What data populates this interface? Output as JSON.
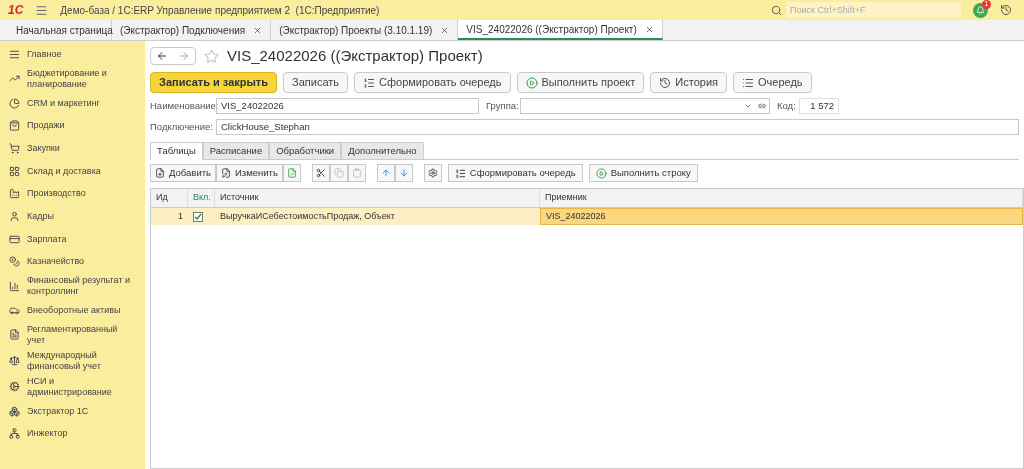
{
  "app": {
    "logo": "1С",
    "title": "Демо-база / 1С:ERP Управление предприятием 2  (1С:Предприятие)",
    "search_placeholder": "Поиск Ctrl+Shift+F",
    "notification_count": "1"
  },
  "tabs": [
    {
      "label": "Начальная страница",
      "kind": "home",
      "selected": false
    },
    {
      "label": "(Экстрактор) Подключения",
      "kind": "doc",
      "selected": false
    },
    {
      "label": "(Экстрактор) Проекты (3.10.1.19)",
      "kind": "doc",
      "selected": false
    },
    {
      "label": "VIS_24022026 ((Экстрактор) Проект)",
      "kind": "doc",
      "selected": true
    }
  ],
  "sidebar": {
    "items": [
      {
        "label": "Главное"
      },
      {
        "label": "Бюджетирование и планирование"
      },
      {
        "label": "CRM и маркетинг"
      },
      {
        "label": "Продажи"
      },
      {
        "label": "Закупки"
      },
      {
        "label": "Склад и доставка"
      },
      {
        "label": "Производство"
      },
      {
        "label": "Кадры"
      },
      {
        "label": "Зарплата"
      },
      {
        "label": "Казначейство"
      },
      {
        "label": "Финансовый результат и контроллинг"
      },
      {
        "label": "Внеоборотные активы"
      },
      {
        "label": "Регламентированный учет"
      },
      {
        "label": "Международный финансовый учет"
      },
      {
        "label": "НСИ и администрирование"
      },
      {
        "label": "Экстрактор 1С"
      },
      {
        "label": "Инжектор"
      }
    ]
  },
  "form": {
    "title": "VIS_24022026 ((Экстрактор) Проект)",
    "buttons": [
      {
        "label": "Записать и закрыть",
        "kind": "primary"
      },
      {
        "label": "Записать",
        "kind": "plain"
      },
      {
        "label": "Сформировать очередь",
        "kind": "queue"
      },
      {
        "label": "Выполнить проект",
        "kind": "run"
      },
      {
        "label": "История",
        "kind": "history"
      },
      {
        "label": "Очередь",
        "kind": "list"
      }
    ],
    "name_label": "Наименование:",
    "name_value": "VIS_24022026",
    "group_label": "Группа:",
    "code_label": "Код:",
    "code_value": "1 572",
    "connection_label": "Подключение:",
    "connection_value": "ClickHouse_Stephan",
    "tabs": [
      {
        "label": "Таблицы",
        "selected": true
      },
      {
        "label": "Расписание",
        "selected": false
      },
      {
        "label": "Обработчики",
        "selected": false
      },
      {
        "label": "Дополнительно",
        "selected": false
      }
    ],
    "toolbar": [
      {
        "label": "Добавить",
        "kind": "add"
      },
      {
        "label": "Изменить",
        "kind": "edit"
      },
      {
        "label": "Сформировать очередь",
        "kind": "queue"
      },
      {
        "label": "Выполнить строку",
        "kind": "run"
      }
    ],
    "table": {
      "columns": [
        "Ид",
        "Вкл.",
        "Источник",
        "Приемник"
      ],
      "rows": [
        {
          "id": "1",
          "checked": true,
          "source": "ВыручкаИСебестоимостьПродаж, Объект",
          "target": "VIS_24022026",
          "selected": true
        }
      ]
    }
  }
}
